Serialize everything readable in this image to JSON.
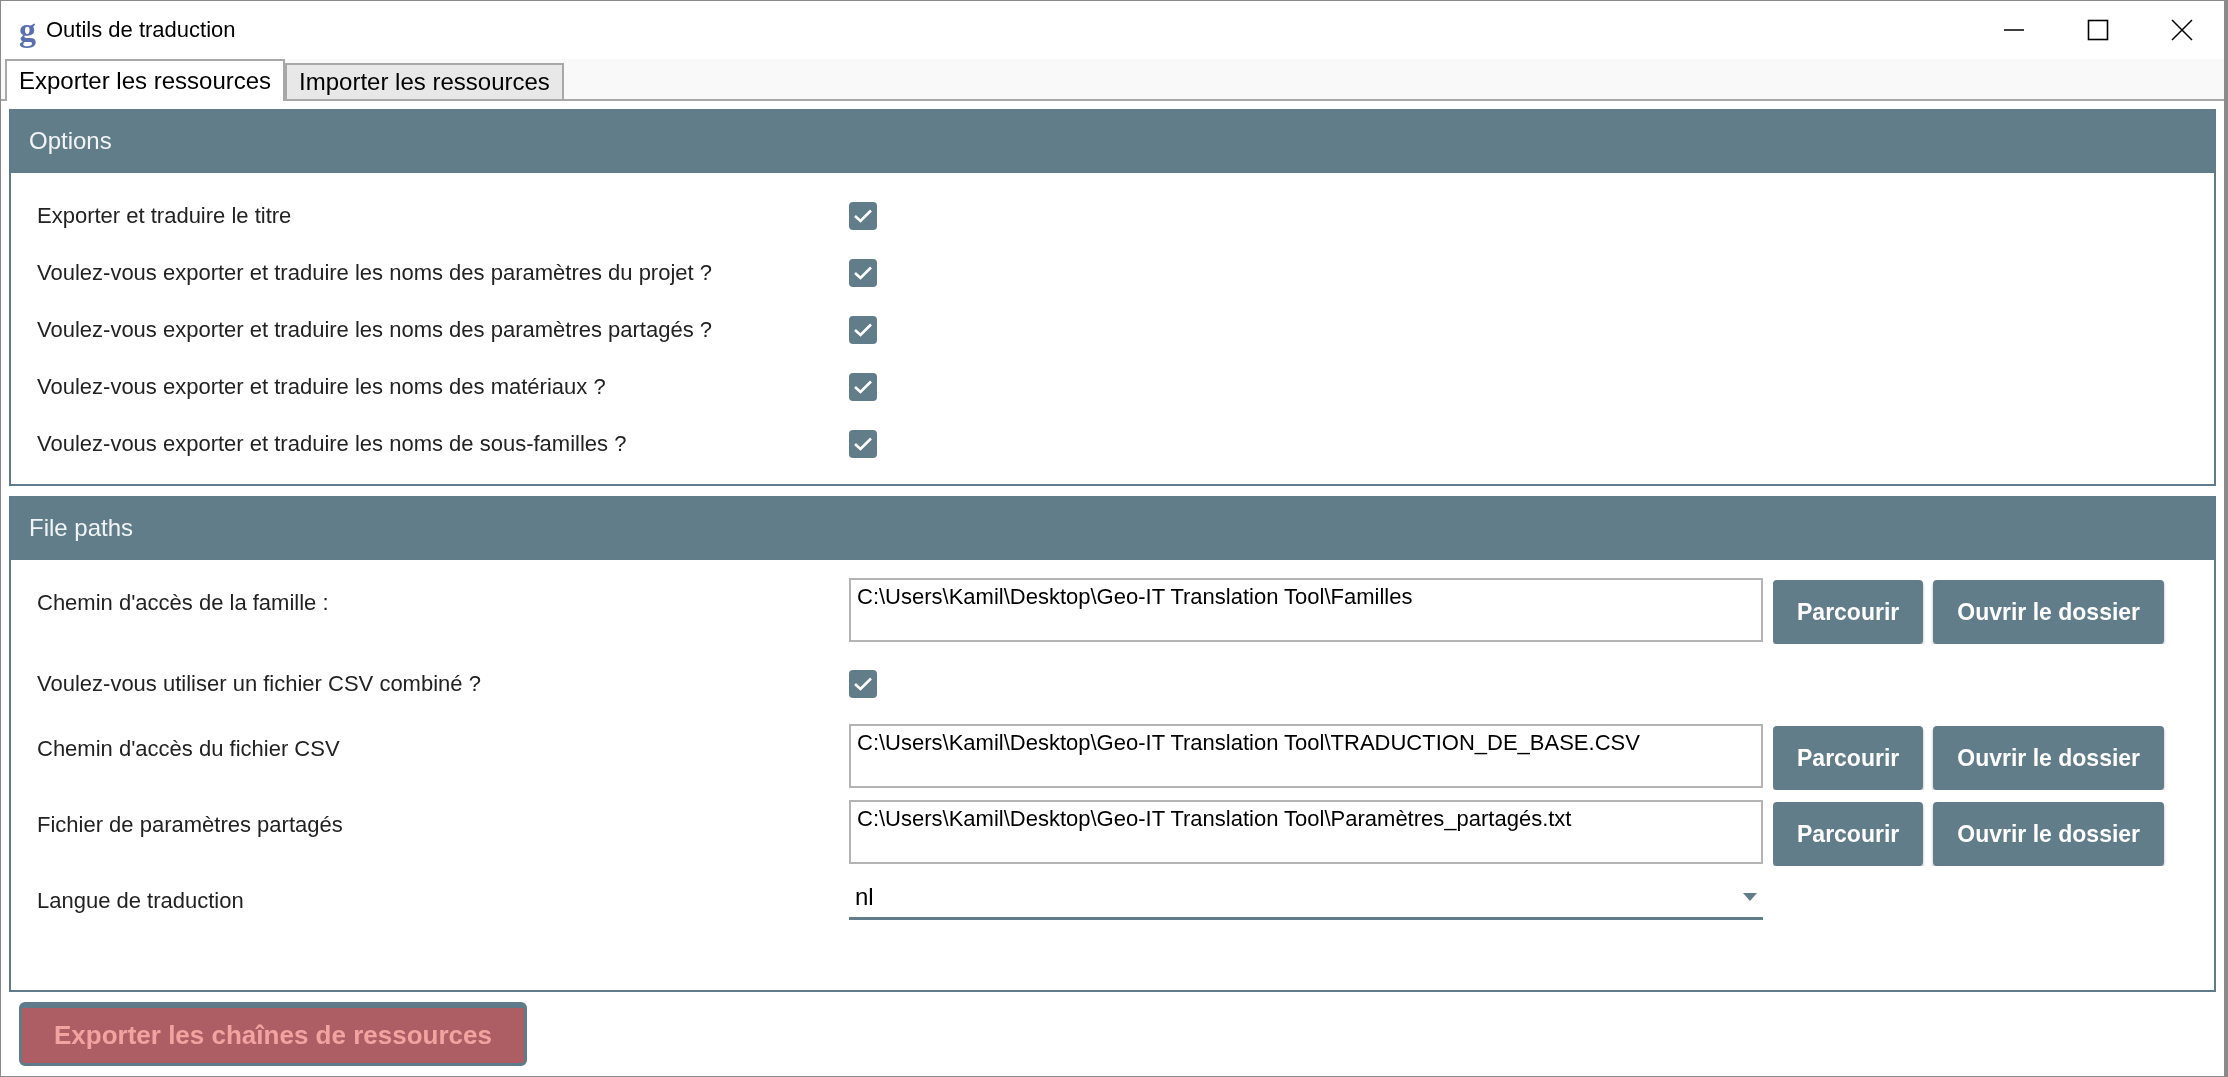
{
  "window": {
    "logo": "g",
    "title": "Outils de traduction"
  },
  "tabs": [
    {
      "label": "Exporter les ressources",
      "selected": true
    },
    {
      "label": "Importer les ressources",
      "selected": false
    }
  ],
  "options": {
    "title": "Options",
    "items": [
      {
        "label": "Exporter et traduire le titre",
        "checked": true
      },
      {
        "label": "Voulez-vous exporter et traduire les noms des paramètres du projet ?",
        "checked": true
      },
      {
        "label": "Voulez-vous exporter et traduire les noms des paramètres partagés ?",
        "checked": true
      },
      {
        "label": "Voulez-vous exporter et traduire les noms des matériaux ?",
        "checked": true
      },
      {
        "label": "Voulez-vous exporter et traduire les noms de sous-familles ?",
        "checked": true
      }
    ]
  },
  "file_paths": {
    "title": "File paths",
    "rows": [
      {
        "kind": "path",
        "label": "Chemin d'accès de la famille :",
        "value": "C:\\Users\\Kamil\\Desktop\\Geo-IT Translation Tool\\Familles",
        "buttons": [
          "Parcourir",
          "Ouvrir le dossier"
        ]
      },
      {
        "kind": "checkbox",
        "label": "Voulez-vous utiliser un fichier CSV combiné ?",
        "checked": true
      },
      {
        "kind": "path",
        "label": "Chemin d'accès du fichier CSV",
        "value": "C:\\Users\\Kamil\\Desktop\\Geo-IT Translation Tool\\TRADUCTION_DE_BASE.CSV",
        "buttons": [
          "Parcourir",
          "Ouvrir le dossier"
        ]
      },
      {
        "kind": "path",
        "label": "Fichier de paramètres partagés",
        "value": "C:\\Users\\Kamil\\Desktop\\Geo-IT Translation Tool\\Paramètres_partagés.txt",
        "buttons": [
          "Parcourir",
          "Ouvrir le dossier"
        ]
      },
      {
        "kind": "select",
        "label": "Langue de traduction",
        "value": "nl"
      }
    ]
  },
  "export_button": {
    "label": "Exporter les chaînes de ressources",
    "disabled": true
  }
}
